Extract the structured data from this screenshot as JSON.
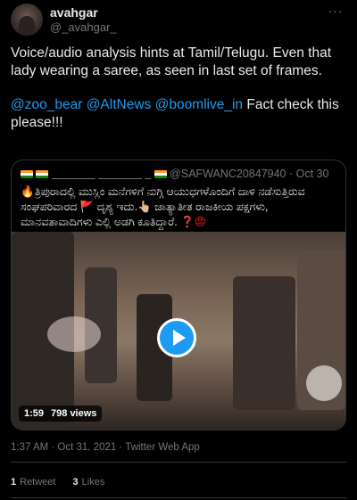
{
  "author": {
    "display_name": "avahgar",
    "handle": "@_avahgar_"
  },
  "header": {
    "more_icon": "···"
  },
  "tweet": {
    "line1": "Voice/audio analysis hints at Tamil/Telugu. Even that lady wearing a saree, as seen in last set of frames.",
    "mentions": [
      "@zoo_bear",
      "@AltNews",
      "@boomlive_in"
    ],
    "line2_suffix": "Fact check this please!!!"
  },
  "quote": {
    "name": "_______ _______ _",
    "handle_time": "@SAFWANC20847940 · Oct 30",
    "text_part1": "🔥ತ್ರಿಪುರಾದಲ್ಲಿ ಮುಸ್ಲಿಂ ಮನೆಗಳಿಗೆ ನುಗ್ಗಿ ಆಯುಧಗಳೊಂದಿಗೆ ದಾಳಿ ನಡೆಸುತ್ತಿರುವ ಸಂಘಪರಿವಾರದ 🚩 ದೃಶ್ಯ ಇದು.👆🏼 ಜಾತ್ಯಾತೀತ ರಾಜಕೀಯ ಪಕ್ಷಗಳು, ಮಾನವತಾವಾದಿಗಳು ಎಲ್ಲಿ ಅಡಗಿ ಕೂತಿದ್ದಾರೆ.",
    "text_part2": "❓😡",
    "video": {
      "duration": "1:59",
      "views": "798 views"
    }
  },
  "meta": {
    "timestamp": "1:37 AM · Oct 31, 2021 · Twitter Web App"
  },
  "stats": {
    "retweets_count": "1",
    "retweets_label": "Retweet",
    "likes_count": "3",
    "likes_label": "Likes"
  },
  "colors": {
    "background": "#000000",
    "text": "#e7e9ea",
    "secondary": "#71767b",
    "link": "#1d9bf0",
    "border": "#2f3336"
  }
}
